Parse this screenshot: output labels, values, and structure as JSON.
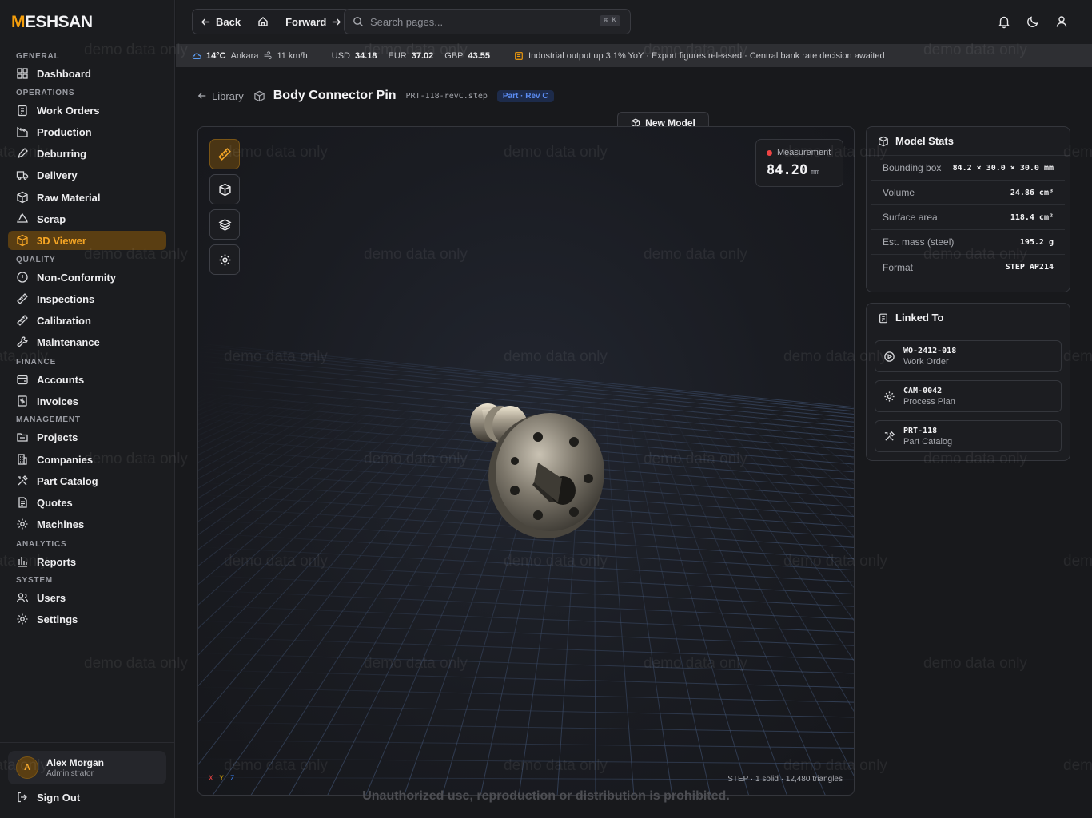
{
  "brand": {
    "name_accent": "M",
    "name_rest": "ESHSAN",
    "accent_color": "#f59e0b"
  },
  "topbar": {
    "back_label": "Back",
    "forward_label": "Forward",
    "search_placeholder": "Search pages...",
    "search_shortcut": "⌘ K"
  },
  "ticker": {
    "temperature": "14°C",
    "city": "Ankara",
    "wind": "11 km/h",
    "usd_label": "USD",
    "usd_value": "34.18",
    "eur_label": "EUR",
    "eur_value": "37.02",
    "gbp_label": "GBP",
    "gbp_value": "43.55",
    "news": "Industrial output up 3.1% YoY · Export figures released · Central bank rate decision awaited"
  },
  "sidebar": {
    "sections": {
      "general": "GENERAL",
      "operations": "OPERATIONS",
      "quality": "QUALITY",
      "finance": "FINANCE",
      "management": "MANAGEMENT",
      "analytics": "ANALYTICS",
      "system": "SYSTEM"
    },
    "items": {
      "dashboard": "Dashboard",
      "work_orders": "Work Orders",
      "production": "Production",
      "deburring": "Deburring",
      "delivery": "Delivery",
      "raw_material": "Raw Material",
      "scrap": "Scrap",
      "viewer_3d": "3D Viewer",
      "non_conformity": "Non-Conformity",
      "inspections": "Inspections",
      "calibration": "Calibration",
      "maintenance": "Maintenance",
      "accounts": "Accounts",
      "invoices": "Invoices",
      "projects": "Projects",
      "companies": "Companies",
      "part_catalog": "Part Catalog",
      "quotes": "Quotes",
      "machines": "Machines",
      "reports": "Reports",
      "users": "Users",
      "settings": "Settings"
    },
    "active_item": "3D Viewer",
    "user": {
      "initial": "A",
      "name": "Alex Morgan",
      "role": "Administrator"
    },
    "sign_out": "Sign Out"
  },
  "breadcrumb": {
    "library": "Library",
    "title": "Body Connector Pin",
    "file": "PRT-118-revC.step",
    "badge": "Part · Rev C"
  },
  "viewer": {
    "new_model_label": "New Model",
    "tools": [
      "ruler-icon",
      "cube-icon",
      "layers-icon",
      "gear-icon"
    ],
    "measurement_label": "Measurement",
    "measurement_value": "84.20",
    "measurement_unit": "mm",
    "axis_x": "X",
    "axis_y": "Y",
    "axis_z": "Z",
    "info": "STEP · 1 solid · 12,480 triangles"
  },
  "model_stats": {
    "title": "Model Stats",
    "rows": [
      {
        "label": "Bounding box",
        "value": "84.2 × 30.0 × 30.0 mm"
      },
      {
        "label": "Volume",
        "value": "24.86 cm³"
      },
      {
        "label": "Surface area",
        "value": "118.4 cm²"
      },
      {
        "label": "Est. mass (steel)",
        "value": "195.2 g"
      },
      {
        "label": "Format",
        "value": "STEP AP214"
      }
    ]
  },
  "linked_to": {
    "title": "Linked To",
    "items": [
      {
        "code": "WO-2412-018",
        "type": "Work Order",
        "icon": "play-circle-icon"
      },
      {
        "code": "CAM-0042",
        "type": "Process Plan",
        "icon": "cog-icon"
      },
      {
        "code": "PRT-118",
        "type": "Part Catalog",
        "icon": "tools-icon"
      }
    ]
  },
  "watermark": "demo data only",
  "footer_notice": "Unauthorized use, reproduction or distribution is prohibited."
}
